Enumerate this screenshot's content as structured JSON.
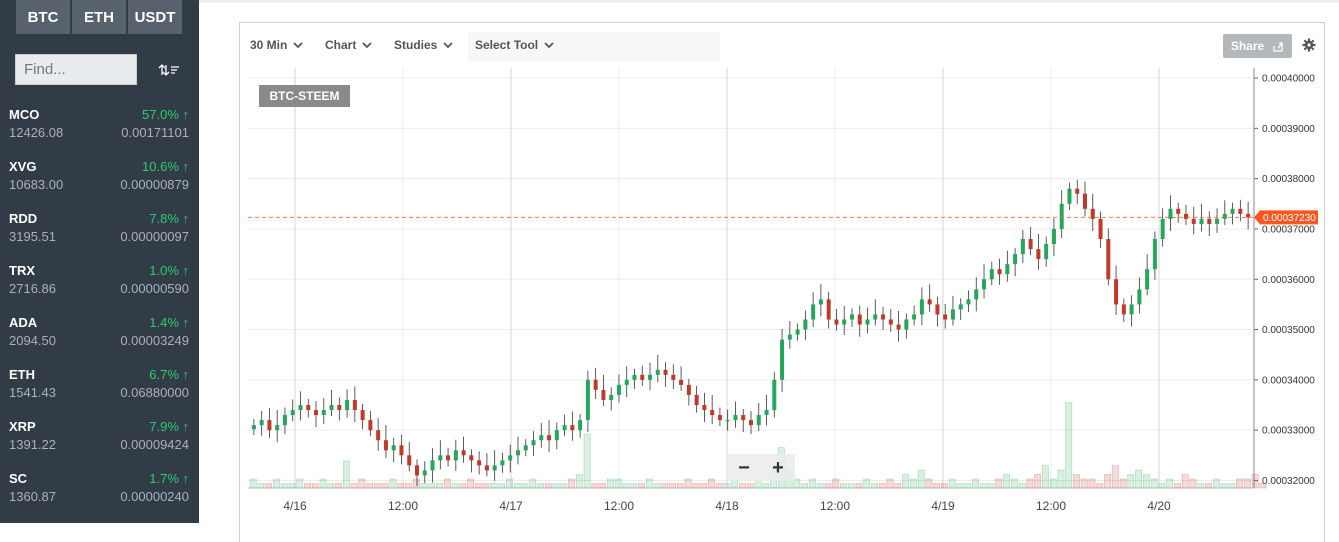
{
  "markets": {
    "tabs": [
      "BTC",
      "ETH",
      "USDT"
    ]
  },
  "search": {
    "placeholder": "Find..."
  },
  "coins": [
    {
      "name": "MCO",
      "volume": "12426.08",
      "change": "57.0% ↑",
      "price": "0.00171101"
    },
    {
      "name": "XVG",
      "volume": "10683.00",
      "change": "10.6% ↑",
      "price": "0.00000879"
    },
    {
      "name": "RDD",
      "volume": "3195.51",
      "change": "7.8% ↑",
      "price": "0.00000097"
    },
    {
      "name": "TRX",
      "volume": "2716.86",
      "change": "1.0% ↑",
      "price": "0.00000590"
    },
    {
      "name": "ADA",
      "volume": "2094.50",
      "change": "1.4% ↑",
      "price": "0.00003249"
    },
    {
      "name": "ETH",
      "volume": "1541.43",
      "change": "6.7% ↑",
      "price": "0.06880000"
    },
    {
      "name": "XRP",
      "volume": "1391.22",
      "change": "7.9% ↑",
      "price": "0.00009424"
    },
    {
      "name": "SC",
      "volume": "1360.87",
      "change": "1.7% ↑",
      "price": "0.00000240"
    }
  ],
  "toolbar": {
    "interval": "30 Min",
    "chart": "Chart",
    "studies": "Studies",
    "select_tool": "Select Tool",
    "share": "Share"
  },
  "symbol": "BTC-STEEM",
  "colors": {
    "up": "#26a65b",
    "down": "#c0392b",
    "last_price": "#ff5722",
    "sidebar_bg": "#323c47"
  },
  "chart_data": {
    "type": "candlestick",
    "y_ticks": [
      "0.00040000",
      "0.00039000",
      "0.00038000",
      "0.00037000",
      "0.00036000",
      "0.00035000",
      "0.00034000",
      "0.00033000",
      "0.00032000"
    ],
    "ylim": [
      0.0003185,
      0.000402
    ],
    "x_ticks": [
      "4/16",
      "12:00",
      "4/17",
      "12:00",
      "4/18",
      "12:00",
      "4/19",
      "12:00",
      "4/20"
    ],
    "last_price": "0.00037230",
    "close_series": [
      0.000331,
      0.000332,
      0.00033,
      0.000331,
      0.000333,
      0.000334,
      0.000335,
      0.000334,
      0.000333,
      0.000334,
      0.000335,
      0.000334,
      0.000336,
      0.000334,
      0.000332,
      0.00033,
      0.000328,
      0.000326,
      0.000327,
      0.000325,
      0.000323,
      0.000321,
      0.000322,
      0.000324,
      0.000325,
      0.000324,
      0.000326,
      0.000325,
      0.000324,
      0.000323,
      0.000322,
      0.000323,
      0.000324,
      0.000325,
      0.000326,
      0.000327,
      0.000328,
      0.000329,
      0.000328,
      0.00033,
      0.000331,
      0.00033,
      0.000332,
      0.00034,
      0.000338,
      0.000336,
      0.000337,
      0.000339,
      0.00034,
      0.000341,
      0.00034,
      0.000341,
      0.000342,
      0.000341,
      0.00034,
      0.000339,
      0.000337,
      0.000335,
      0.000334,
      0.000333,
      0.000332,
      0.000332,
      0.000333,
      0.000332,
      0.000331,
      0.000333,
      0.000334,
      0.00034,
      0.000348,
      0.000349,
      0.00035,
      0.000352,
      0.000355,
      0.000356,
      0.000352,
      0.000351,
      0.000352,
      0.000353,
      0.000351,
      0.000352,
      0.000353,
      0.000352,
      0.000351,
      0.00035,
      0.000352,
      0.000353,
      0.000356,
      0.000355,
      0.000353,
      0.000352,
      0.000354,
      0.000355,
      0.000356,
      0.000358,
      0.00036,
      0.000362,
      0.000361,
      0.000363,
      0.000365,
      0.000368,
      0.000366,
      0.000364,
      0.000367,
      0.00037,
      0.000375,
      0.000378,
      0.000377,
      0.000374,
      0.000372,
      0.000368,
      0.00036,
      0.000355,
      0.000353,
      0.000355,
      0.000358,
      0.000362,
      0.000368,
      0.000372,
      0.000374,
      0.000373,
      0.000372,
      0.000371,
      0.000372,
      0.000371,
      0.000372,
      0.000373,
      0.000374,
      0.000373,
      0.0003723
    ],
    "volume_series": [
      2,
      1,
      1,
      2,
      1,
      1,
      2,
      1,
      1,
      2,
      1,
      1,
      6,
      1,
      2,
      1,
      1,
      1,
      2,
      1,
      1,
      2,
      1,
      1,
      1,
      2,
      1,
      1,
      2,
      1,
      1,
      1,
      1,
      2,
      1,
      1,
      2,
      1,
      1,
      1,
      1,
      2,
      3,
      12,
      1,
      1,
      2,
      2,
      1,
      1,
      1,
      2,
      1,
      1,
      1,
      1,
      2,
      1,
      1,
      2,
      1,
      1,
      2,
      1,
      1,
      2,
      1,
      3,
      9,
      4,
      2,
      1,
      2,
      1,
      1,
      2,
      1,
      1,
      1,
      2,
      1,
      1,
      2,
      1,
      3,
      2,
      4,
      2,
      1,
      1,
      2,
      1,
      1,
      2,
      1,
      1,
      2,
      3,
      2,
      1,
      2,
      3,
      5,
      2,
      4,
      19,
      3,
      2,
      2,
      1,
      3,
      5,
      2,
      3,
      4,
      3,
      2,
      1,
      2,
      1,
      3,
      2,
      1,
      1,
      2,
      1,
      1,
      2,
      2,
      3,
      1
    ]
  }
}
